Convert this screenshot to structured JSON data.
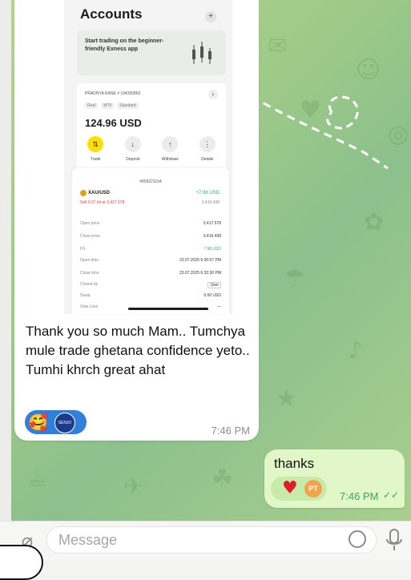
{
  "screenshot": {
    "title": "Accounts",
    "promo_text": "Start trading on the beginner-friendly Exness app",
    "account_name": "PRADNYA RANE  # 194260862",
    "account_tags": [
      "Real",
      "MT5",
      "Standard"
    ],
    "balance": "124.96 USD",
    "actions": [
      "Trade",
      "Deposit",
      "Withdraw",
      "Details"
    ],
    "detail": {
      "order_id": "#859221154",
      "symbol": "XAU/USD",
      "pl_top": "+7.98 USD",
      "sell_text": "Sell 0.07 lot at 3,417.578",
      "price_right": "3,416.438",
      "rows": [
        {
          "label": "Open price",
          "value": "3,417.578"
        },
        {
          "label": "Close price",
          "value": "3,416.438"
        },
        {
          "label": "P/L",
          "value": "7.98 USD"
        },
        {
          "label": "Open time",
          "value": "23.07.2025 6:30:57 PM"
        },
        {
          "label": "Close time",
          "value": "23.07.2025 6:32:30 PM"
        },
        {
          "label": "Closed by",
          "value": "User"
        },
        {
          "label": "Swap",
          "value": "0.00 USD"
        },
        {
          "label": "Stop Loss",
          "value": "—"
        }
      ]
    }
  },
  "incoming_message": {
    "text": "Thank you so much Mam.. Tumchya mule trade ghetana confidence yeto.. Tumhi khrch great ahat",
    "reactions": {
      "emoji": "🥰",
      "avatar_text": "SENJO"
    },
    "time": "7:46 PM"
  },
  "outgoing_message": {
    "text": "thanks",
    "reactions": {
      "emoji": "♥",
      "avatar_initials": "PT"
    },
    "time": "7:46 PM",
    "status": "✓✓"
  },
  "input": {
    "placeholder": "Message"
  },
  "colors": {
    "outgoing_bubble": "#e1f7c8",
    "reaction_in": "#2f7fdd",
    "exness_yellow": "#ffde02"
  }
}
